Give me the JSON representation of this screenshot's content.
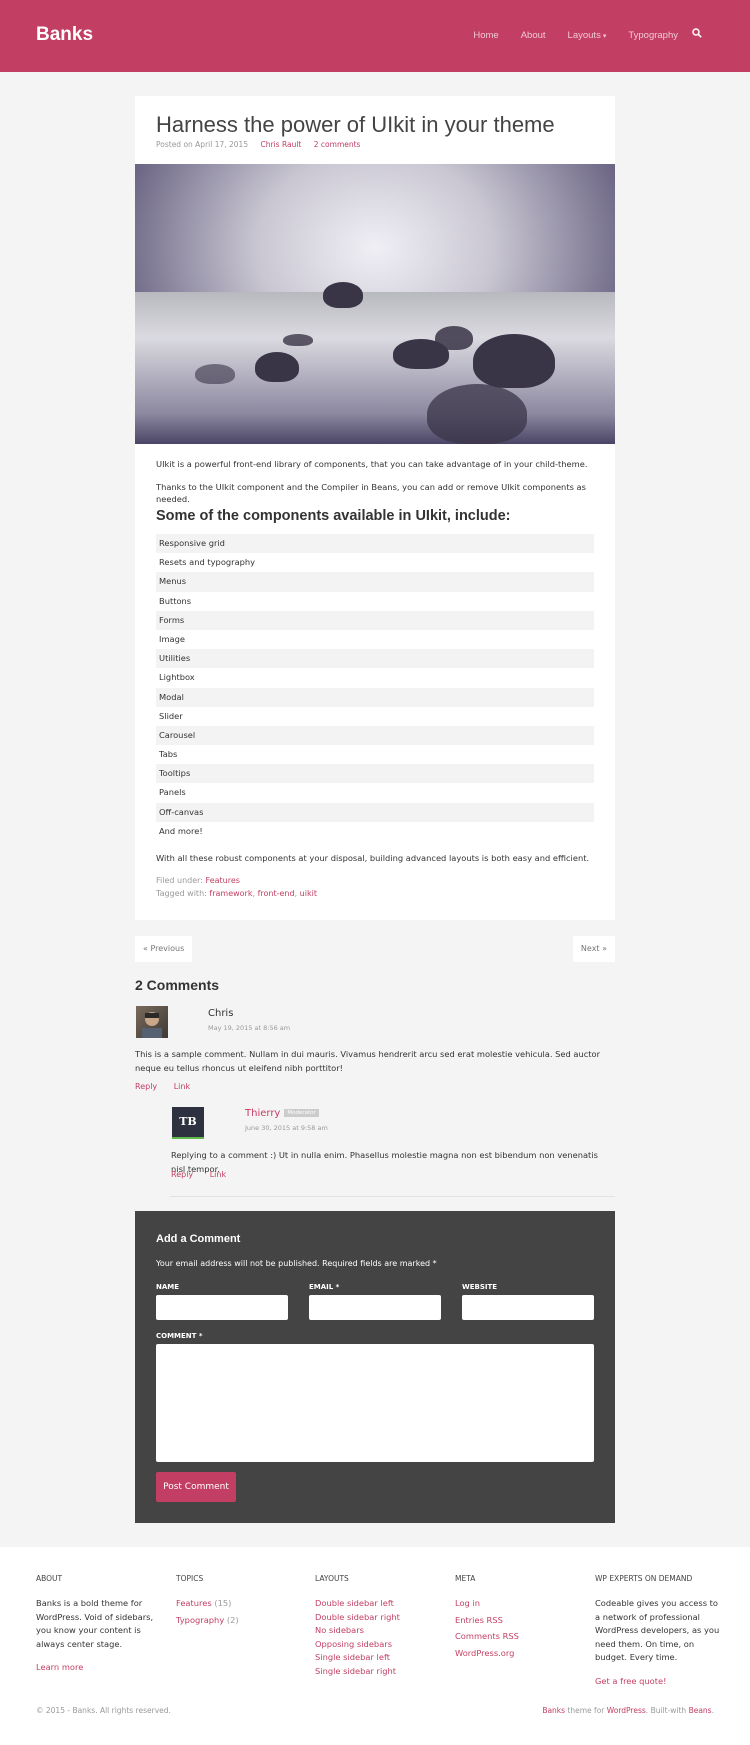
{
  "site": {
    "logo": "Banks",
    "nav": [
      "Home",
      "About",
      "Layouts",
      "Typography"
    ]
  },
  "post": {
    "title": "Harness the power of UIkit in your theme",
    "posted_on": "Posted on April 17, 2015",
    "author": "Chris Rault",
    "comments_link": "2 comments",
    "intro_1": "UIkit is a powerful front-end library of components, that you can take advantage of in your child-theme.",
    "intro_2": "Thanks to the UIkit component and the Compiler in Beans, you can add or remove UIkit components as needed.",
    "heading": "Some of the components available in UIkit, include:",
    "components": [
      "Responsive grid",
      "Resets and typography",
      "Menus",
      "Buttons",
      "Forms",
      "Image",
      "Utilities",
      "Lightbox",
      "Modal",
      "Slider",
      "Carousel",
      "Tabs",
      "Tooltips",
      "Panels",
      "Off-canvas",
      "And more!"
    ],
    "outro": "With all these robust components at your disposal, building advanced layouts is both easy and efficient.",
    "filed_label": "Filed under:",
    "filed_value": "Features",
    "tagged_label": "Tagged with:",
    "tags": [
      "framework",
      "front-end",
      "uikit"
    ]
  },
  "pager": {
    "previous": "« Previous",
    "next": "Next »"
  },
  "comments": {
    "title": "2 Comments",
    "items": [
      {
        "author": "Chris",
        "date": "May 19, 2015 at 8:56 am",
        "text": "This is a sample comment. Nullam in dui mauris. Vivamus hendrerit arcu sed erat molestie vehicula. Sed auctor neque eu tellus rhoncus ut eleifend nibh porttitor!",
        "reply": "Reply",
        "link": "Link"
      },
      {
        "author": "Thierry",
        "badge": "Moderator",
        "date": "June 30, 2015 at 9:58 am",
        "text": "Replying to a comment :) Ut in nulla enim. Phasellus molestie magna non est bibendum non venenatis nisl tempor.",
        "reply": "Reply",
        "link": "Link",
        "avatar_text": "TB"
      }
    ]
  },
  "form": {
    "title": "Add a Comment",
    "note": "Your email address will not be published. Required fields are marked *",
    "name_label": "NAME",
    "email_label": "EMAIL *",
    "website_label": "WEBSITE",
    "comment_label": "COMMENT *",
    "submit": "Post Comment"
  },
  "footer": {
    "about": {
      "heading": "ABOUT",
      "text": "Banks is a bold theme for WordPress. Void of sidebars, you know your content is always center stage.",
      "link": "Learn more"
    },
    "topics": {
      "heading": "TOPICS",
      "items": [
        {
          "label": "Features",
          "count": "(15)"
        },
        {
          "label": "Typography",
          "count": "(2)"
        }
      ]
    },
    "layouts": {
      "heading": "LAYOUTS",
      "items": [
        "Double sidebar left",
        "Double sidebar right",
        "No sidebars",
        "Opposing sidebars",
        "Single sidebar left",
        "Single sidebar right"
      ]
    },
    "meta": {
      "heading": "META",
      "items": [
        "Log in",
        "Entries RSS",
        "Comments RSS",
        "WordPress.org"
      ]
    },
    "experts": {
      "heading": "WP EXPERTS ON DEMAND",
      "text": "Codeable gives you access to a network of professional WordPress developers, as you need them. On time, on budget. Every time.",
      "link": "Get a free quote!"
    },
    "copyright": "© 2015 - Banks. All rights reserved.",
    "credit_a": "Banks",
    "credit_b": " theme for ",
    "credit_c": "WordPress",
    "credit_d": ". Built-with ",
    "credit_e": "Beans",
    "credit_f": "."
  },
  "colors": {
    "accent": "#c23e63",
    "form_bg": "#444444",
    "page_bg": "#f4f4f4"
  },
  "icons": {
    "search": "search-icon"
  }
}
